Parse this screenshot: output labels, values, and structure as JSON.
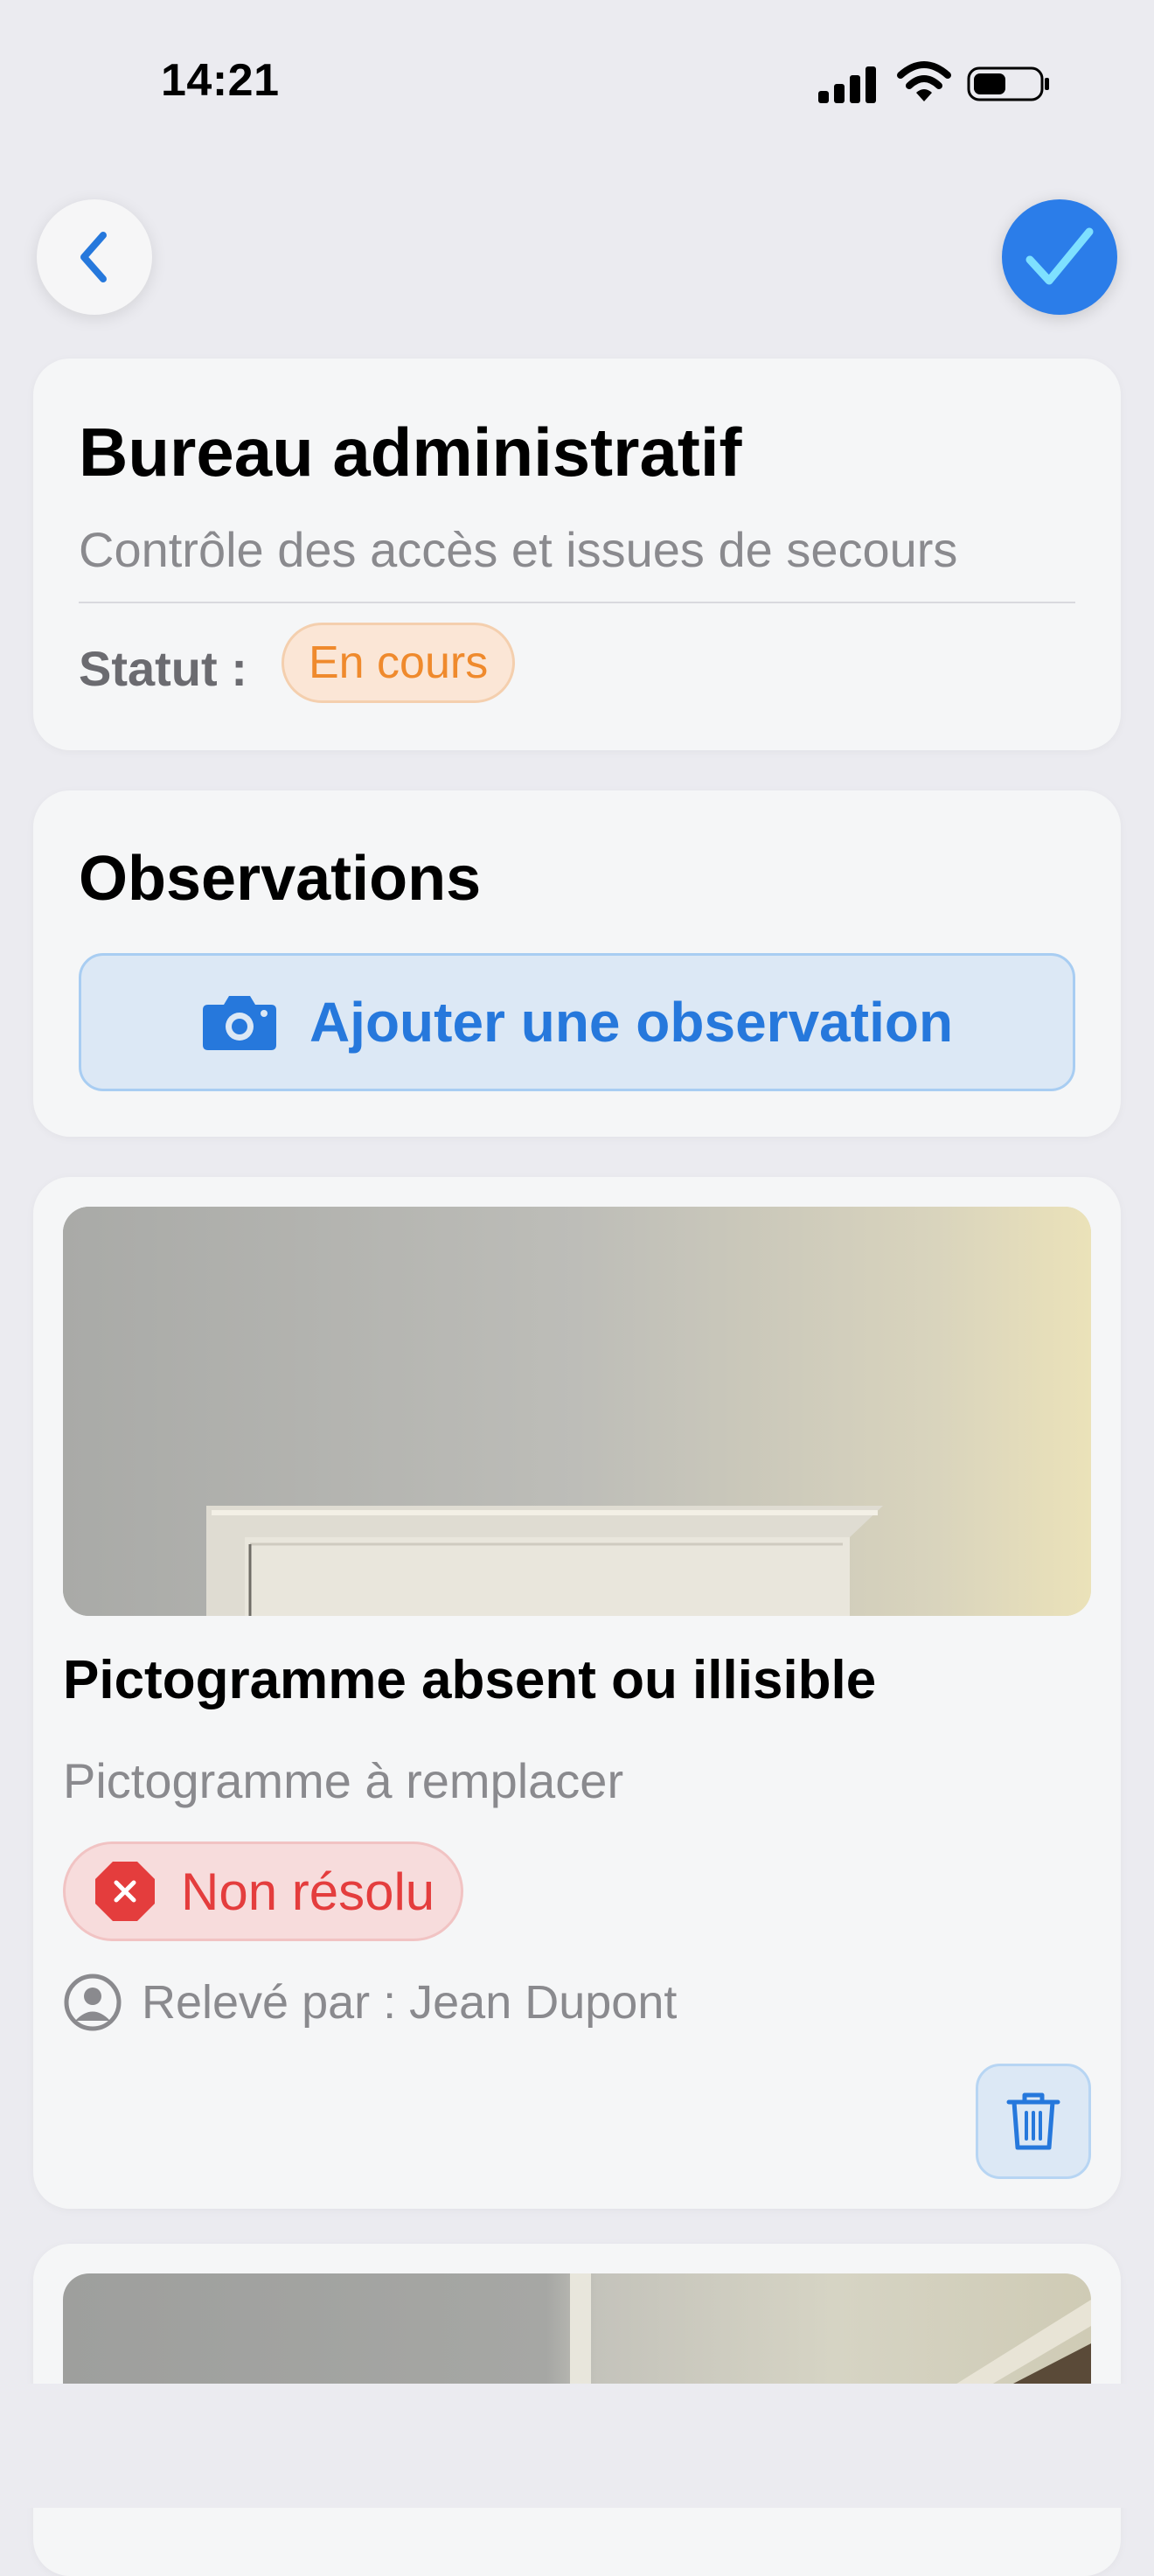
{
  "status_bar": {
    "time": "14:21",
    "icons": [
      "cellular-signal-icon",
      "wifi-icon",
      "battery-icon"
    ]
  },
  "nav": {
    "back_icon": "chevron-left-icon",
    "done_icon": "checkmark-icon"
  },
  "header": {
    "title": "Bureau administratif",
    "subtitle": "Contrôle des accès et issues de secours",
    "status_label": "Statut :",
    "status_value": "En cours",
    "status_color": "#ef8a2d"
  },
  "observations": {
    "title": "Observations",
    "add_label": "Ajouter une observation",
    "add_icon": "camera-icon",
    "accent": "#2678dc"
  },
  "items": [
    {
      "title": "Pictogramme absent ou illisible",
      "description": "Pictogramme à remplacer",
      "status": "Non résolu",
      "status_icon": "x-octagon-icon",
      "status_color": "#e43d3d",
      "reporter": "Relevé par : Jean Dupont",
      "reporter_icon": "person-circle-icon",
      "delete_icon": "trash-icon"
    }
  ]
}
